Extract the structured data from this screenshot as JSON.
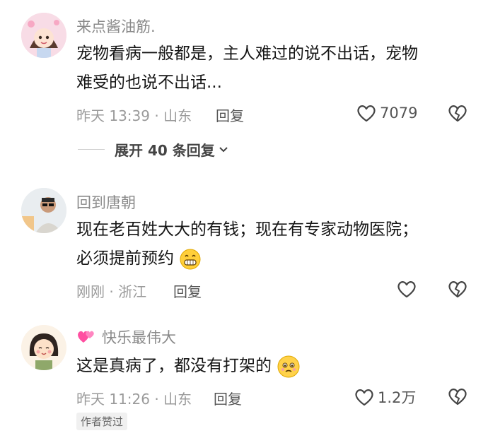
{
  "comments": [
    {
      "username": "来点酱油筋.",
      "line1": "宠物看病一般都是，主人难过的说不出话，宠物",
      "line2": "难受的也说不出话...",
      "meta": "昨天 13:39 · 山东",
      "reply_label": "回复",
      "like_count": "7079",
      "expand_label": "展开 40 条回复"
    },
    {
      "username": "回到唐朝",
      "line1": "现在老百姓大大的有钱；现在有专家动物医院；",
      "line2": "必须提前预约",
      "meta": "刚刚 · 浙江",
      "reply_label": "回复",
      "like_count": ""
    },
    {
      "username": "快乐最伟大",
      "line1": "这是真病了，都没有打架的",
      "meta": "昨天 11:26 · 山东",
      "reply_label": "回复",
      "like_count": "1.2万",
      "author_badge": "作者赞过"
    }
  ],
  "colors": {
    "text": "#161616",
    "muted": "#9a9a9a",
    "username": "#8a8a8a",
    "badge_bg": "#f0f0f0"
  }
}
